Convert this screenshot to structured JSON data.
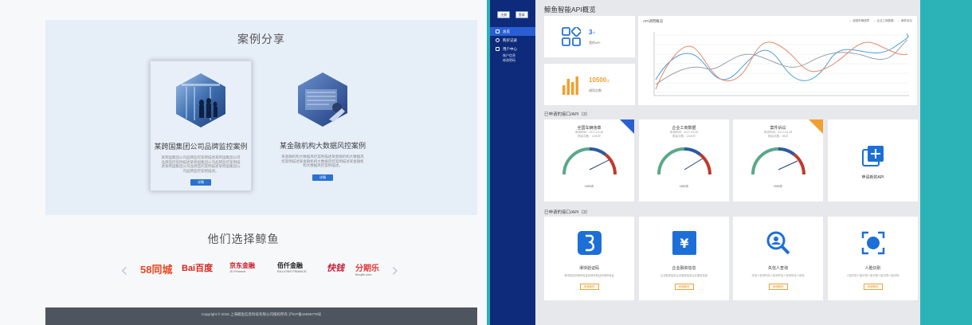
{
  "left": {
    "case_section_title": "案例分享",
    "cases": [
      {
        "name": "某跨国集团公司品牌监控案例",
        "desc": "某跨国集团公司品牌监控案例描述某跨国集团公司品牌监控案例描述某跨国集团公司品牌监控案例描述某跨国集团公司品牌监控案例描述某跨国集团公司品牌监控案例描述。",
        "button": "详情"
      },
      {
        "name": "某金融机构大数据风控案例",
        "desc": "某金融机构大数据风控案例描述某金融机构大数据风控案例描述某金融机构大数据风控案例描述某金融机构大数据风控案例描述。",
        "button": "详情"
      }
    ],
    "partners_title": "他们选择鲸鱼",
    "partners": [
      {
        "name": "58同城",
        "sub": ""
      },
      {
        "name": "Bai百度",
        "sub": ""
      },
      {
        "name": "京东金融",
        "sub": "JD Finance"
      },
      {
        "name": "佰仟金融",
        "sub": "BILLIONS FINANCE"
      },
      {
        "name": "快钱",
        "sub": ""
      },
      {
        "name": "分期乐",
        "sub": "fenqile.com"
      }
    ],
    "footer": "Copyright © 2016 上海鲸鱼信息科技有限公司版权所有 沪ICP备15055779号"
  },
  "right": {
    "sidebar": {
      "top_buttons": [
        "注册",
        "登录"
      ],
      "items": [
        {
          "label": "总览",
          "icon": "home-icon",
          "active": true
        },
        {
          "label": "购买记录",
          "icon": "gear-icon",
          "active": false
        },
        {
          "label": "用户中心",
          "icon": "user-icon",
          "active": false
        }
      ],
      "subitems": [
        "账户信息",
        "修改密码"
      ]
    },
    "title": "鲸鱼智能API概览",
    "stats": [
      {
        "value": "3",
        "unit": "个",
        "label": "我的API",
        "color": "#2a72d0"
      },
      {
        "value": "10500",
        "unit": "次",
        "label": "调用总数",
        "color": "#f0a030"
      }
    ],
    "chart": {
      "title": "API调用概览",
      "legend": [
        "全国车辆违章",
        "企业工商数据",
        "案件诉讼"
      ]
    },
    "applied_label": "已申请的接口/API（3）",
    "apis": [
      {
        "name": "全国车辆违章",
        "meta1": "申请时间：2017-03-28",
        "meta2": "剩余次数：1300次",
        "gauge": "1500次",
        "corner": "blue"
      },
      {
        "name": "企业工商数据",
        "meta1": "申请时间：2017-03-28",
        "meta2": "剩余次数：1300次",
        "gauge": "1500次",
        "corner": ""
      },
      {
        "name": "案件诉讼",
        "meta1": "申请时间：2017-03-28",
        "meta2": "剩余次数：98次",
        "gauge": "1500次",
        "corner": "orange"
      }
    ],
    "apply_new": "申请新的API",
    "applied_label2": "已申请的接口/API（3）",
    "services": [
      {
        "name": "滑块验证码",
        "desc": "滑块验证码滑块验证码滑块验证码滑块验证",
        "button": "申请新的",
        "icon": "slider-captcha-icon"
      },
      {
        "name": "企业融资信息",
        "desc": "企业融资信息企业融资信息企业融资信息",
        "button": "申请新的",
        "icon": "yuan-icon"
      },
      {
        "name": "失信人查询",
        "desc": "失信人查询失信人查询失信人查询失信人查询",
        "button": "申请新的",
        "icon": "search-person-icon"
      },
      {
        "name": "人脸识别",
        "desc": "人脸识别人脸识别人脸识别人脸识别人脸识别",
        "button": "申请新的",
        "icon": "face-scan-icon"
      }
    ]
  }
}
